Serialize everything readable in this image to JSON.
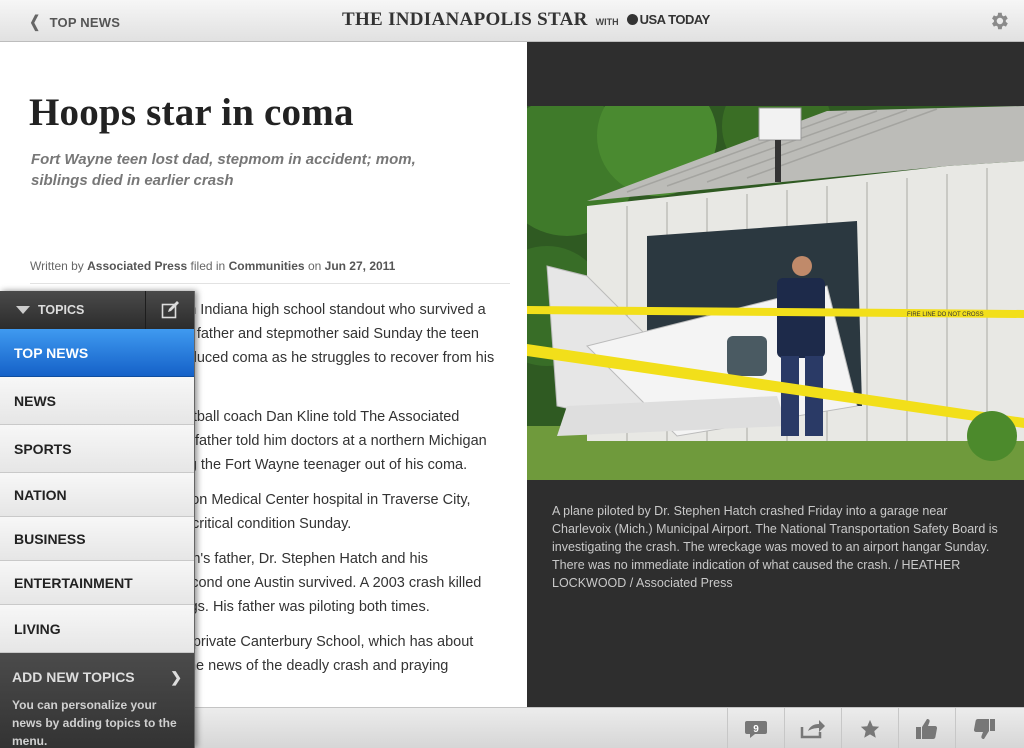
{
  "header": {
    "back_label": "TOP NEWS",
    "masthead_name": "THE INDIANAPOLIS STAR",
    "masthead_with": "WITH",
    "masthead_partner": "USA TODAY"
  },
  "article": {
    "headline": "Hoops star in coma",
    "subhead": "Fort Wayne teen lost dad, stepmom in accident; mom, siblings died in earlier crash",
    "byline": {
      "written_by_prefix": "Written by",
      "author": "Associated Press",
      "filed_in_prefix": "filed in",
      "section": "Communities",
      "on_prefix": "on",
      "date": "Jun 27, 2011"
    },
    "paragraphs": [
      "FORT WAYNE, Ind. — An Indiana high school standout who survived a plane crash that killed his father and stepmother said Sunday the teen remains in a medically induced coma as he struggles to recover from his injuries.",
      "Canterbury School basketball coach Dan Kline told The Associated Press that Austin Hatch’s father told him doctors at a northern Michigan hospital are trying to bring the Fort Wayne teenager out of his coma.",
      "A spokeswoman at Munson Medical Center hospital in Traverse City, Mich., said Austin was in critical condition Sunday.",
      "Friday's crash killed Austin's father, Dr. Stephen Hatch and his stepmother. It was the second one Austin survived. A 2003 crash killed his mother and two siblings. His father was piloting both times.",
      "Austin is a student at the private Canterbury School, which has about 400 students reeling by the news of the deadly crash and praying"
    ]
  },
  "photo": {
    "caption": "A plane piloted by Dr. Stephen Hatch crashed Friday into a garage near Charlevoix (Mich.) Municipal Airport. The National Transportation Safety Board is investigating the crash. The wreckage was moved to an airport hangar Sunday. There was no immediate indication of what caused the crash. / HEATHER LOCKWOOD / Associated Press",
    "tape_text": "FIRE LINE DO NOT CROSS"
  },
  "topics": {
    "header_label": "TOPICS",
    "items": [
      "TOP NEWS",
      "NEWS",
      "SPORTS",
      "NATION",
      "BUSINESS",
      "ENTERTAINMENT",
      "LIVING"
    ],
    "active_index": 0,
    "add_title": "ADD NEW TOPICS",
    "add_desc": "You can personalize your news by adding topics to the menu."
  },
  "toolbar": {
    "comments_count": "9",
    "icons": [
      "comments-icon",
      "share-icon",
      "star-icon",
      "thumbs-up-icon",
      "thumbs-down-icon"
    ]
  },
  "colors": {
    "active_topic": "#1f6fd6",
    "photo_panel_bg": "#2e2e2e",
    "caution_tape": "#f2df1a"
  }
}
